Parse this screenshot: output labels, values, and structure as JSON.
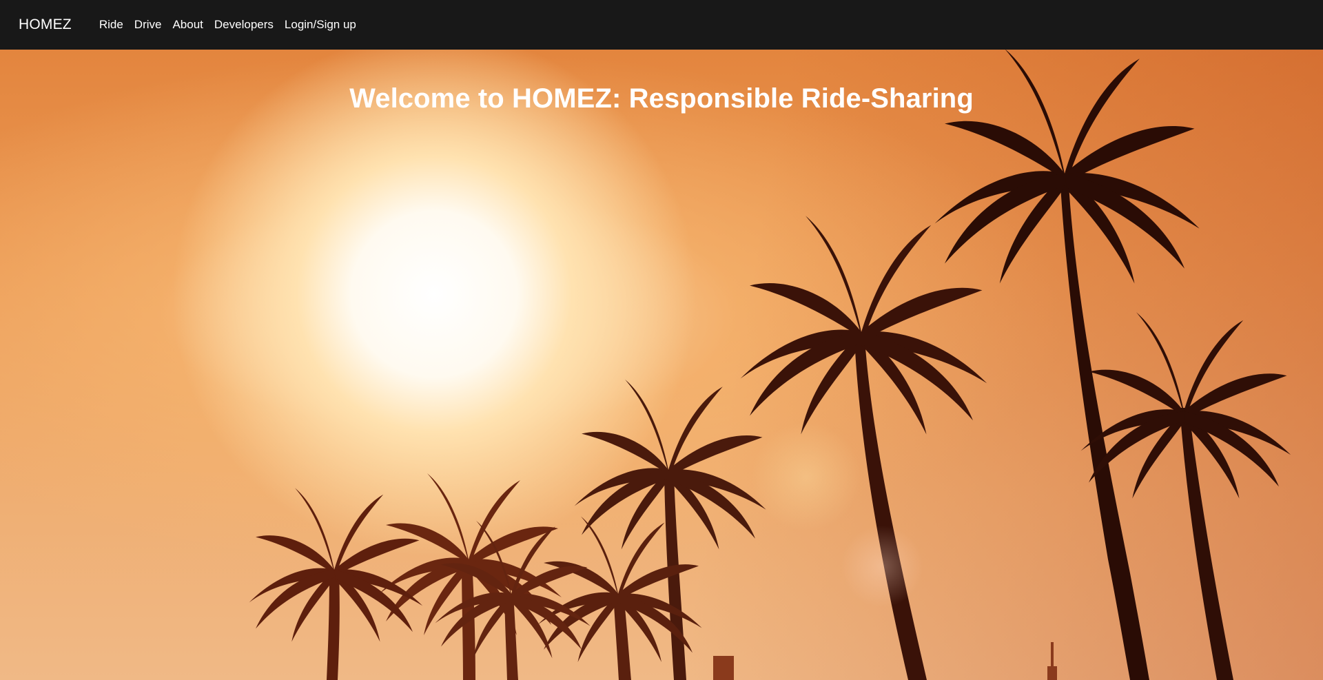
{
  "brand": "HOMEZ",
  "nav": {
    "links": [
      "Ride",
      "Drive",
      "About",
      "Developers",
      "Login/Sign up"
    ]
  },
  "hero": {
    "title": "Welcome to HOMEZ: Responsible Ride-Sharing",
    "image": "sunset-palm-trees-background"
  },
  "colors": {
    "navbar": "#181818",
    "sky_warm": "#e3853e",
    "sky_light": "#f0b986",
    "sun": "#ffffff",
    "palm_silhouette": "#3a1208"
  }
}
